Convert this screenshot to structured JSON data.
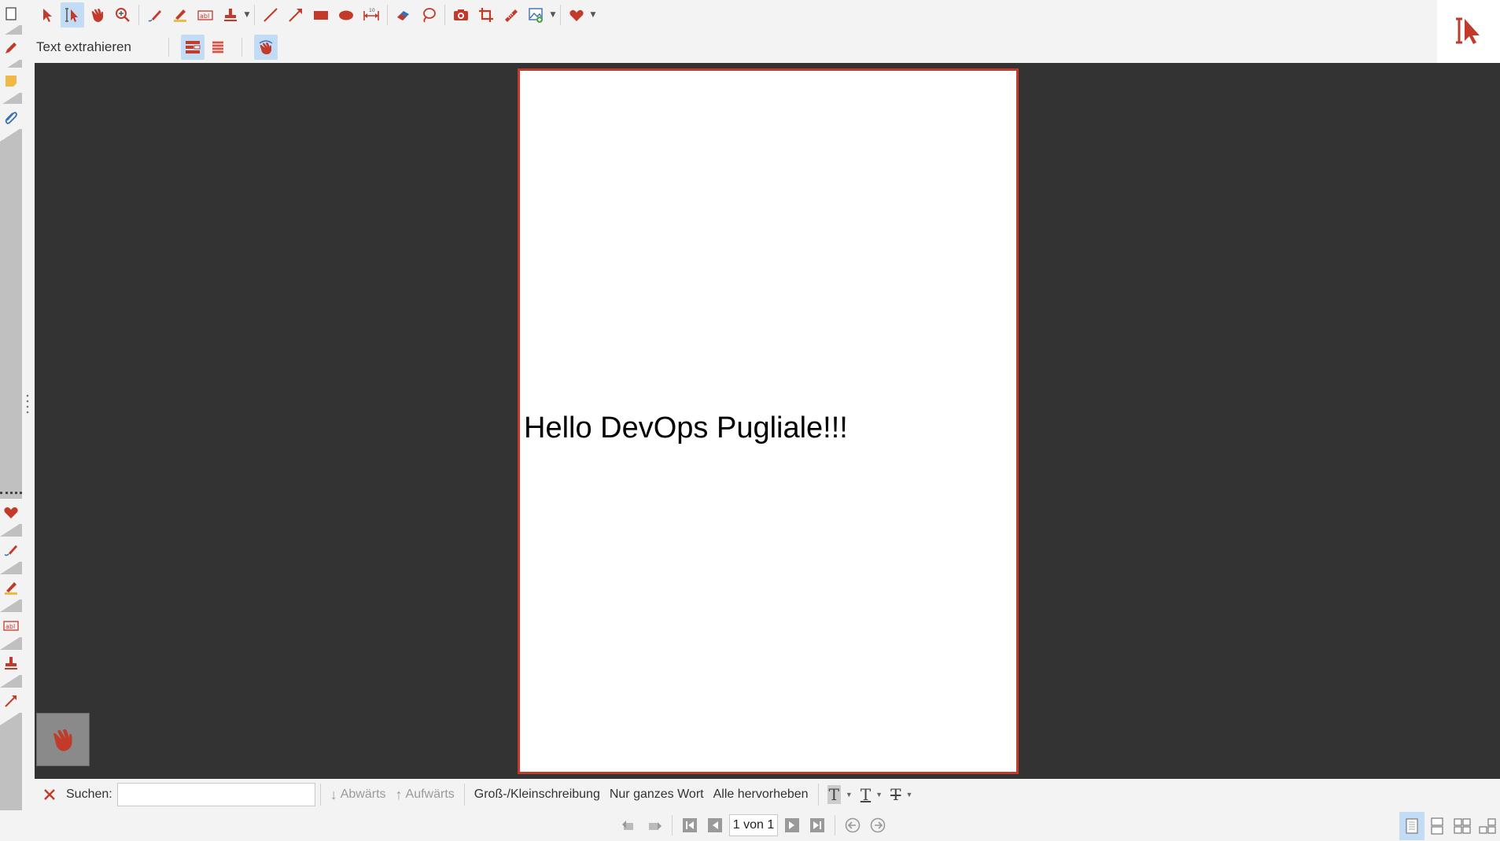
{
  "toolbar": {
    "mode_label": "Text extrahieren",
    "tools": [
      {
        "name": "select-arrow-icon"
      },
      {
        "name": "text-select-icon"
      },
      {
        "name": "hand-icon"
      },
      {
        "name": "zoom-in-icon"
      },
      {
        "name": "pen-icon"
      },
      {
        "name": "highlighter-icon"
      },
      {
        "name": "textbox-icon"
      },
      {
        "name": "stamp-icon"
      },
      {
        "name": "line-icon"
      },
      {
        "name": "arrow-icon"
      },
      {
        "name": "rectangle-icon"
      },
      {
        "name": "ellipse-icon"
      },
      {
        "name": "measure-icon"
      },
      {
        "name": "eraser-icon"
      },
      {
        "name": "lasso-icon"
      },
      {
        "name": "camera-icon"
      },
      {
        "name": "crop-icon"
      },
      {
        "name": "ruler-pencil-icon"
      },
      {
        "name": "insert-image-icon"
      },
      {
        "name": "favorite-heart-icon"
      }
    ],
    "measure_badge": "10"
  },
  "sidebar": {
    "items": [
      {
        "name": "sidebar-item-pages"
      },
      {
        "name": "sidebar-item-annotations"
      },
      {
        "name": "sidebar-item-notes"
      },
      {
        "name": "sidebar-item-attachments"
      },
      {
        "name": "sidebar-item-favorites"
      },
      {
        "name": "sidebar-item-pen"
      },
      {
        "name": "sidebar-item-highlighter"
      },
      {
        "name": "sidebar-item-textbox"
      },
      {
        "name": "sidebar-item-stamp"
      },
      {
        "name": "sidebar-item-arrow"
      }
    ]
  },
  "document": {
    "text": "Hello DevOps Pugliale!!!"
  },
  "search": {
    "label": "Suchen:",
    "value": "",
    "down_label": "Abwärts",
    "up_label": "Aufwärts",
    "match_case_label": "Groß-/Kleinschreibung",
    "whole_word_label": "Nur ganzes Wort",
    "highlight_all_label": "Alle hervorheben"
  },
  "navigation": {
    "page_display": "1 von 1"
  },
  "colors": {
    "accent": "#c23a2a",
    "canvas_bg": "#333333",
    "active_bg": "#c3dcf5",
    "chrome_bg": "#f3f3f3"
  }
}
